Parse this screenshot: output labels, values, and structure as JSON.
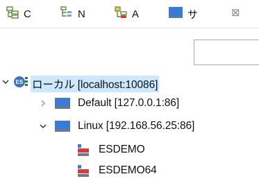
{
  "tabs": [
    {
      "label": "C",
      "icon": "connection-tree-icon"
    },
    {
      "label": "N",
      "icon": "node-list-icon"
    },
    {
      "label": "A",
      "icon": "app-tree-icon"
    },
    {
      "label": "サ",
      "icon": "server-icon"
    }
  ],
  "tree": {
    "root": {
      "label": "ローカル [localhost:10086]",
      "icon": "es-icon"
    },
    "servers": [
      {
        "label": "Default [127.0.0.1:86]",
        "expanded": false
      },
      {
        "label": "Linux [192.168.56.25:86]",
        "expanded": true,
        "children": [
          {
            "label": "ESDEMO"
          },
          {
            "label": "ESDEMO64"
          }
        ]
      }
    ]
  },
  "colors": {
    "selection": "#cce8ff",
    "server_blue": "#3a7bd5",
    "region_red": "#d83b3b",
    "es_badge": "#3c6fc8"
  }
}
